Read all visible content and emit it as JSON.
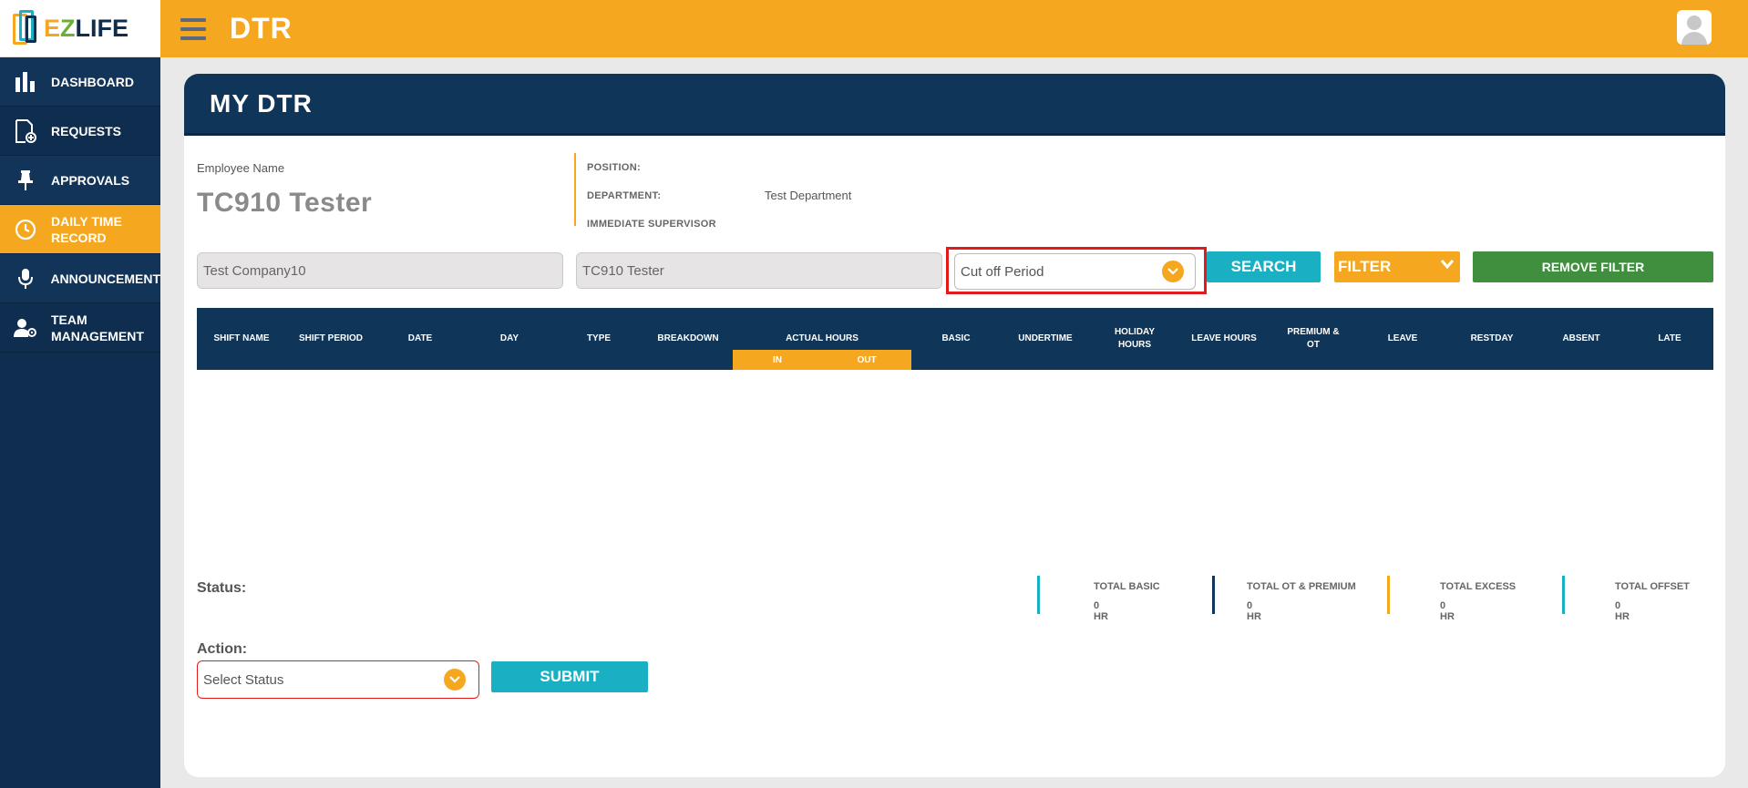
{
  "app": {
    "logo_prefix": "EZ",
    "logo_e": "E",
    "logo_z": "Z",
    "logo_suffix": "LIFE"
  },
  "topbar": {
    "title": "DTR"
  },
  "sidebar": {
    "items": [
      {
        "label": "DASHBOARD",
        "icon": "bar-chart-icon"
      },
      {
        "label": "REQUESTS",
        "icon": "document-add-icon"
      },
      {
        "label": "APPROVALS",
        "icon": "pin-icon"
      },
      {
        "label": "DAILY TIME RECORD",
        "icon": "clock-icon"
      },
      {
        "label": "ANNOUNCEMENT",
        "icon": "microphone-icon"
      },
      {
        "label": "TEAM MANAGEMENT",
        "icon": "user-gear-icon"
      }
    ]
  },
  "card": {
    "title": "MY DTR"
  },
  "employee": {
    "label": "Employee Name",
    "name": "TC910 Tester",
    "position_label": "POSITION:",
    "position_value": "",
    "department_label": "DEPARTMENT:",
    "department_value": "Test Department",
    "supervisor_label": "IMMEDIATE SUPERVISOR",
    "supervisor_value": ""
  },
  "filters": {
    "company": "Test Company10",
    "employee": "TC910 Tester",
    "cutoff_placeholder": "Cut off Period",
    "search_label": "SEARCH",
    "filter_label": "FILTER",
    "remove_filter_label": "REMOVE FILTER"
  },
  "table": {
    "columns": [
      "SHIFT NAME",
      "SHIFT PERIOD",
      "DATE",
      "DAY",
      "TYPE",
      "BREAKDOWN",
      "BASIC",
      "UNDERTIME",
      "HOLIDAY HOURS",
      "LEAVE HOURS",
      "PREMIUM & OT",
      "LEAVE",
      "RESTDAY",
      "ABSENT",
      "LATE"
    ],
    "actual_hours": {
      "label": "ACTUAL HOURS",
      "in": "IN",
      "out": "OUT"
    }
  },
  "summary": {
    "status_label": "Status:",
    "totals": [
      {
        "label": "TOTAL BASIC",
        "value": "0 HR",
        "color": "#1ab0c4"
      },
      {
        "label": "TOTAL OT & PREMIUM",
        "value": "0 HR",
        "color": "#0f3559"
      },
      {
        "label": "TOTAL EXCESS",
        "value": "0 HR",
        "color": "#f5a81f"
      },
      {
        "label": "TOTAL OFFSET",
        "value": "0 HR",
        "color": "#1ab0c4"
      }
    ]
  },
  "action": {
    "label": "Action:",
    "status_placeholder": "Select Status",
    "submit_label": "SUBMIT"
  },
  "colors": {
    "accent": "#f5a81f",
    "navy": "#0f3559",
    "teal": "#1ab0c4",
    "green": "#3f8f3f",
    "highlight": "#e11b1b"
  }
}
